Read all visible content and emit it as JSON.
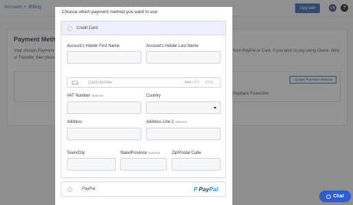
{
  "topbar": {
    "breadcrumb": [
      "Account",
      "Billing"
    ],
    "breadcrumb_separator": ">",
    "upgrade_label": "Upgrade",
    "avatar_initials": "UB",
    "help_label": "?"
  },
  "background": {
    "title": "Payment Metho",
    "desc_line1": "Your chosen Payment",
    "desc_line2": "or Transfer, then pleas",
    "desc_right": "from PayPal or Card. If you wish to pay using Check, Wire",
    "update_button": "Update Payment Method",
    "payback_text": "Payback Protection"
  },
  "modal": {
    "header": "Choose which payment method you want to use",
    "credit_card_label": "Credit Card",
    "first_name_label": "Account's Holder First Name",
    "last_name_label": "Account's Holder Last Name",
    "card_number_placeholder": "Card number",
    "card_expiry_placeholder": "MM / YY",
    "card_cvv_placeholder": "CVV",
    "vat_label": "VAT Number",
    "vat_optional": "Optional",
    "country_label": "Country",
    "address_label": "Address",
    "address2_label": "Address Line 2",
    "address2_optional": "Optional",
    "city_label": "Town/City",
    "state_label": "State/Province",
    "state_optional": "Optional",
    "zip_label": "Zip/Postal Code",
    "paypal_label": "PayPal",
    "paypal_logo_pay": "Pay",
    "paypal_logo_pal": "Pal",
    "paypal_logo_mark": "P"
  },
  "chat": {
    "label": "Chat",
    "icon": "chat-bubble-icon"
  },
  "colors": {
    "accent": "#3d6fb0",
    "chat": "#2d5dd0",
    "cc_option_bg": "#edf0fb",
    "paypal_dark": "#253b80",
    "paypal_light": "#179bd7"
  }
}
